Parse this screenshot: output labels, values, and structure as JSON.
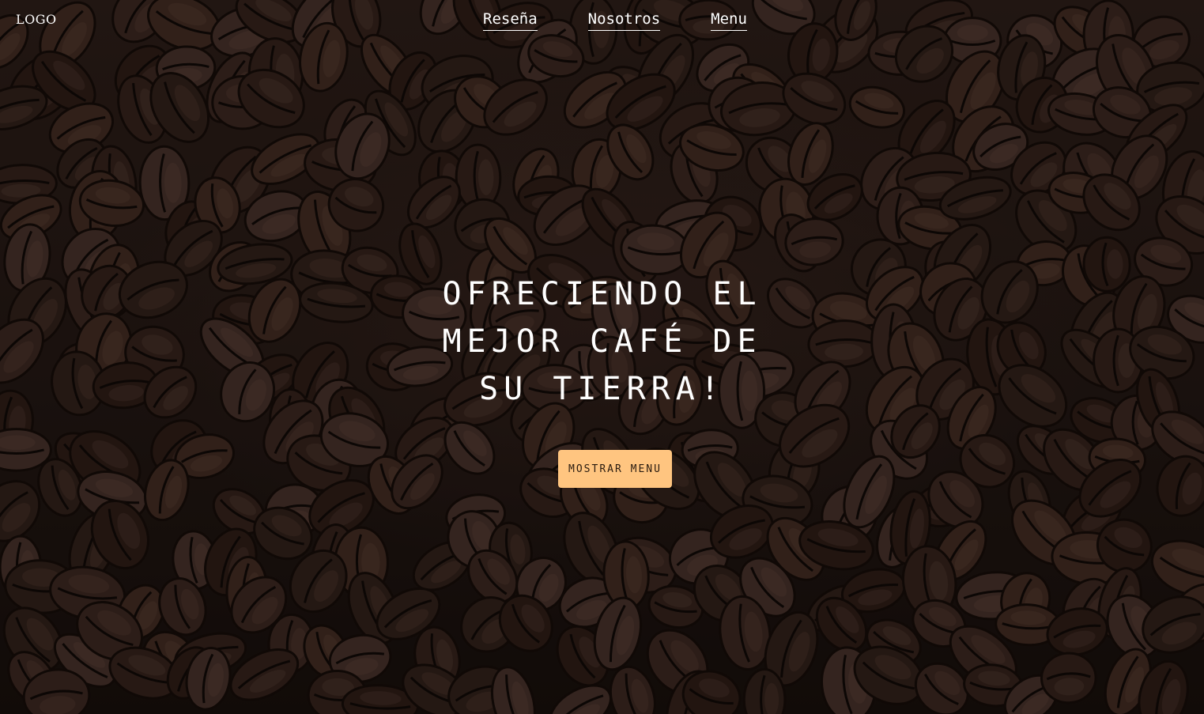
{
  "header": {
    "logo": "LOGO",
    "nav": [
      {
        "label": "Reseña"
      },
      {
        "label": "Nosotros"
      },
      {
        "label": "Menu"
      }
    ]
  },
  "hero": {
    "headline_lines": [
      "OFRECIENDO EL",
      "MEJOR CAFÉ DE",
      "SU TIERRA!"
    ],
    "cta_label": "MOSTRAR MENU",
    "background": "coffee-beans-photo"
  },
  "colors": {
    "cta_background": "#ffc580",
    "text": "#ffffff",
    "background_dark": "#1f1512"
  }
}
